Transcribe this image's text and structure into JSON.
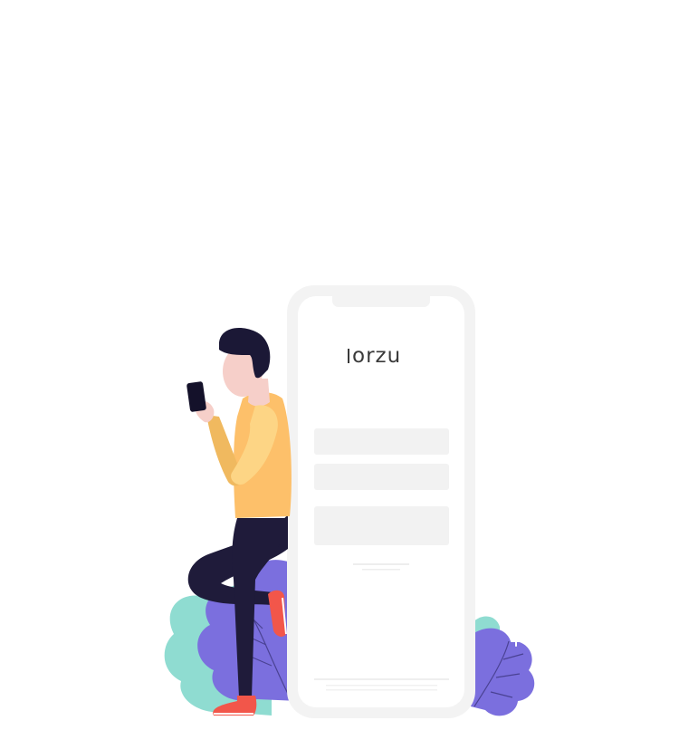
{
  "phone": {
    "brand": "orzu"
  },
  "colors": {
    "phone_frame": "#f3f3f3",
    "phone_screen": "#ffffff",
    "field": "#f2f2f2",
    "leaf_teal": "#8fdcd1",
    "leaf_purple": "#7b6fde",
    "shirt": "#fdc06a",
    "sleeve": "#fdd585",
    "pants": "#1f1b3a",
    "hair": "#1b1836",
    "skin": "#f6cfc9",
    "shoe": "#f2564a"
  }
}
